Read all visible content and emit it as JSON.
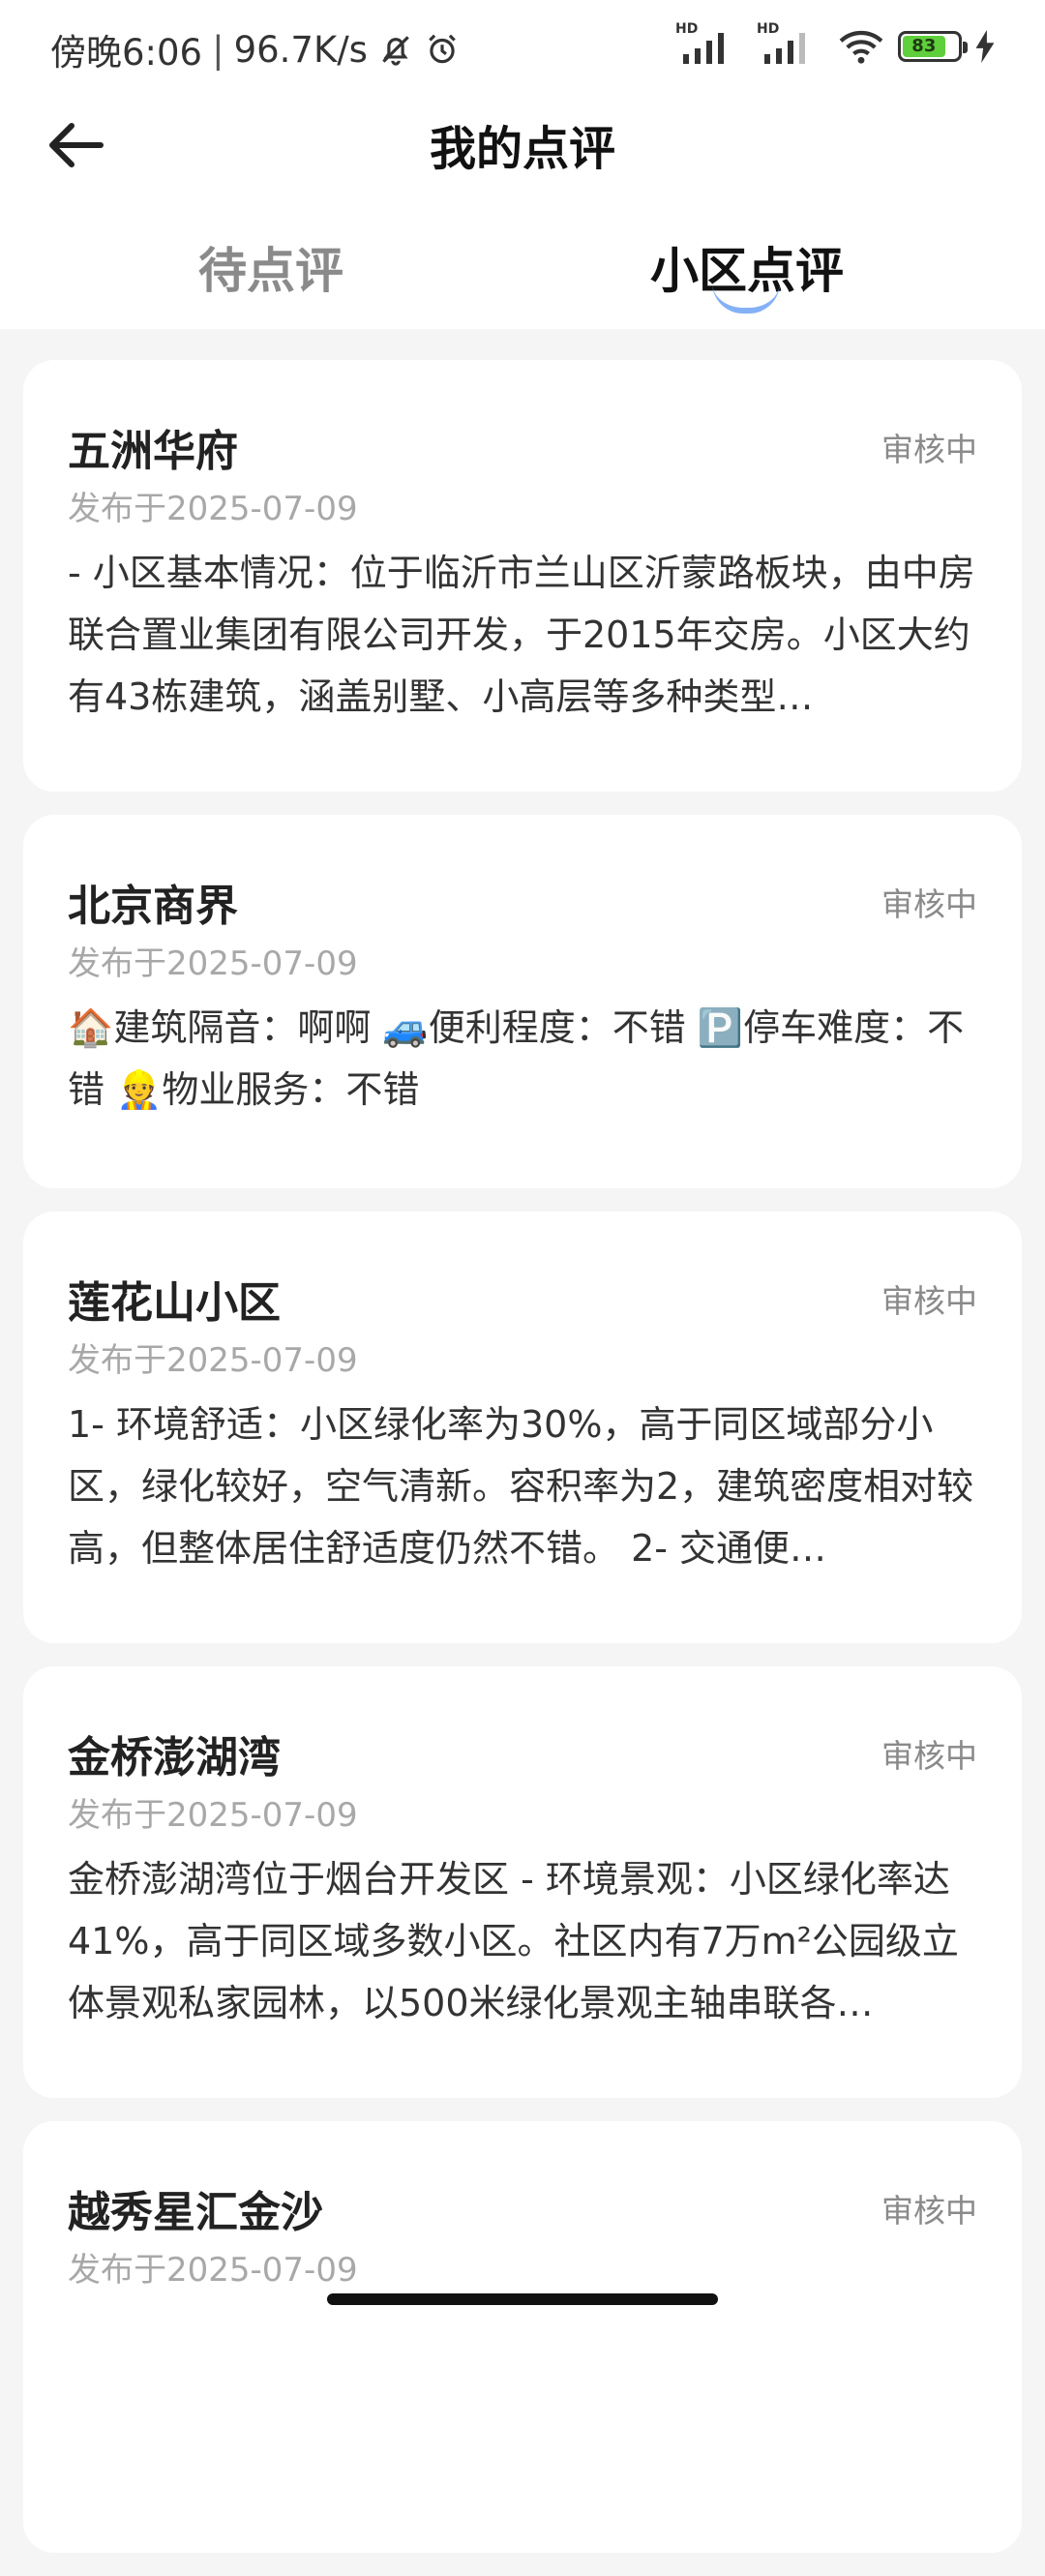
{
  "status_bar": {
    "time": "傍晚6:06",
    "speed": "96.7K/s",
    "hd1": "HD",
    "hd2": "HD",
    "battery": "83"
  },
  "header": {
    "title": "我的点评"
  },
  "tabs": [
    {
      "label": "待点评",
      "active": false
    },
    {
      "label": "小区点评",
      "active": true
    }
  ],
  "reviews": [
    {
      "name": "五洲华府",
      "status": "审核中",
      "date": "发布于2025-07-09",
      "content": "- 小区基本情况：位于临沂市兰山区沂蒙路板块，由中房联合置业集团有限公司开发，于2015年交房。小区大约有43栋建筑，涵盖别墅、小高层等多种类型…"
    },
    {
      "name": "北京商界",
      "status": "审核中",
      "date": "发布于2025-07-09",
      "content": "🏠建筑隔音：啊啊 🚙便利程度：不错 🅿️停车难度：不错 👷物业服务：不错"
    },
    {
      "name": "莲花山小区",
      "status": "审核中",
      "date": "发布于2025-07-09",
      "content": "1- 环境舒适：小区绿化率为30%，高于同区域部分小区，绿化较好，空气清新。容积率为2，建筑密度相对较高，但整体居住舒适度仍然不错。 2- 交通便…"
    },
    {
      "name": "金桥澎湖湾",
      "status": "审核中",
      "date": "发布于2025-07-09",
      "content": "金桥澎湖湾位于烟台开发区 - 环境景观：小区绿化率达41%，高于同区域多数小区。社区内有7万m²公园级立体景观私家园林，以500米绿化景观主轴串联各…"
    },
    {
      "name": "越秀星汇金沙",
      "status": "审核中",
      "date": "发布于2025-07-09",
      "content": ""
    }
  ]
}
